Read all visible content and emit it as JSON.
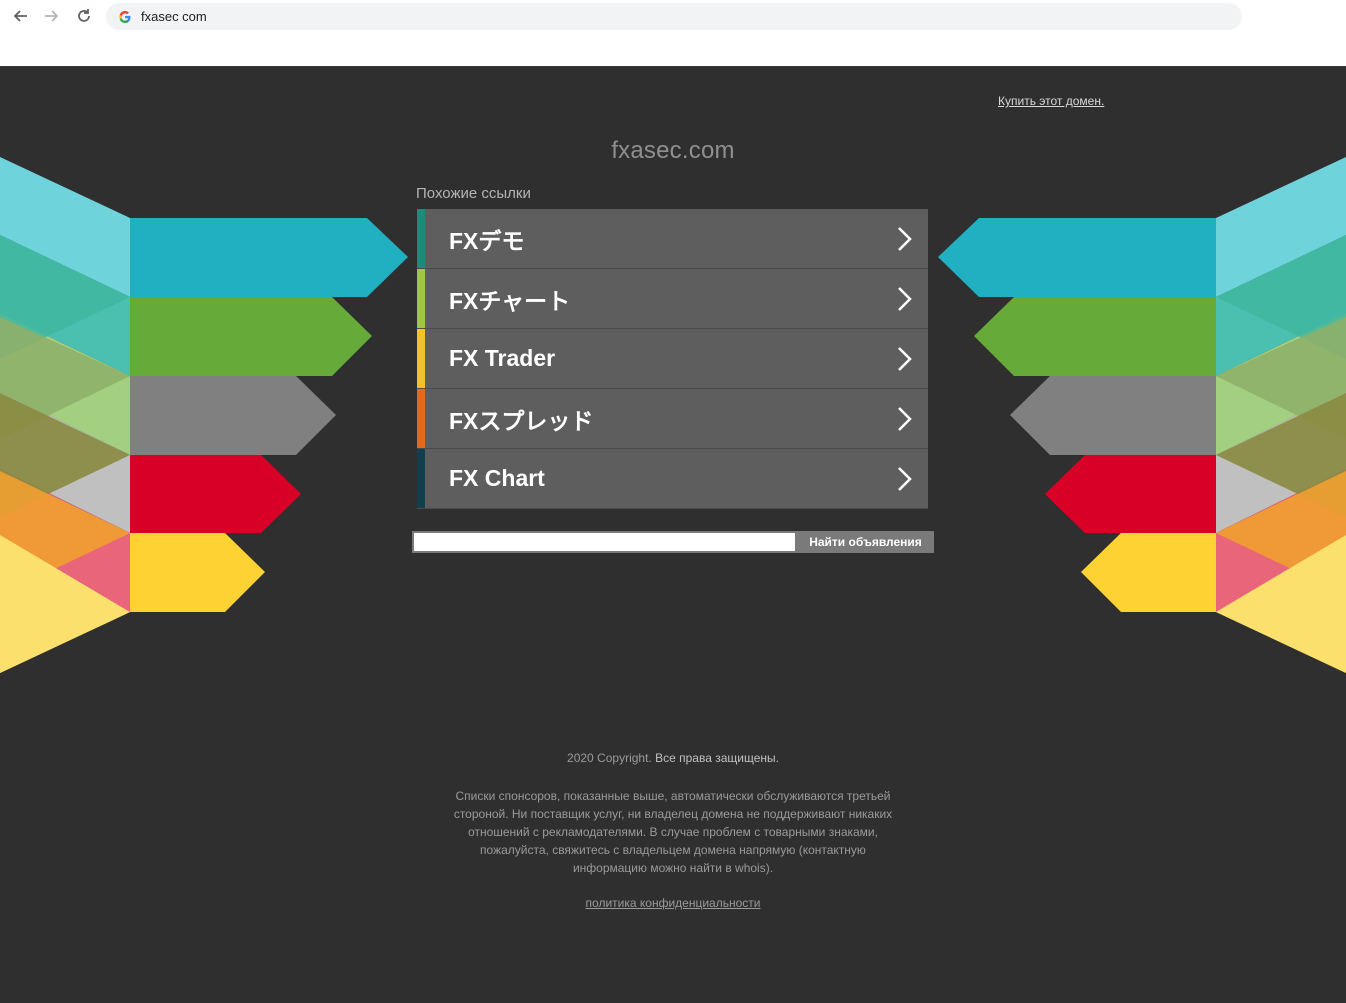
{
  "browser": {
    "url": "fxasec com"
  },
  "page": {
    "buy_domain": "Купить этот домен.",
    "domain_title": "fxasec.com",
    "related_label": "Похожие ссылки",
    "links": [
      {
        "label": "FXデモ",
        "color": "#1f8a7a"
      },
      {
        "label": "FXチャート",
        "color": "#9fc64a"
      },
      {
        "label": "FX Trader",
        "color": "#f2c22d"
      },
      {
        "label": "FXスプレッド",
        "color": "#e06b21"
      },
      {
        "label": "FX Chart",
        "color": "#123e4d"
      }
    ],
    "search": {
      "placeholder": "",
      "button_label": "Найти объявления"
    },
    "copyright_year": "2020 Copyright.",
    "copyright_rights": "Все права защищены.",
    "disclaimer": "Списки спонсоров, показанные выше, автоматически обслуживаются третьей стороной. Ни поставщик услуг, ни владелец домена не поддерживают никаких отношений с рекламодателями. В случае проблем с товарными знаками, пожалуйста, свяжитесь с владельцем домена напрямую (контактную информацию можно найти в whois).",
    "privacy_link": "политика конфиденциальности"
  },
  "colors": {
    "background": "#2f2f2f",
    "teal": "#21b0c2",
    "green": "#66aa3a",
    "gray": "#808080",
    "red": "#d90028",
    "yellow": "#fed233"
  }
}
